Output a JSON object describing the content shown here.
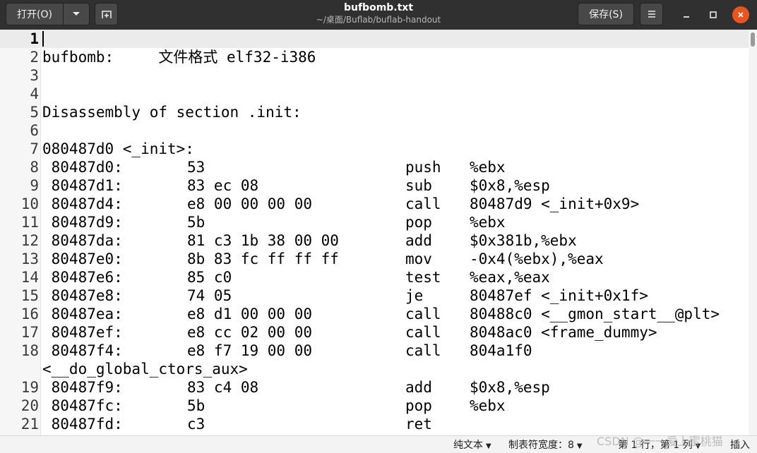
{
  "window": {
    "title": "bufbomb.txt",
    "path": "~/桌面/Buflab/buflab-handout"
  },
  "toolbar": {
    "open_label": "打开(O)",
    "save_label": "保存(S)"
  },
  "editor": {
    "lines": [
      {
        "n": "1",
        "text": ""
      },
      {
        "n": "2",
        "text": "bufbomb:     文件格式 elf32-i386"
      },
      {
        "n": "3",
        "text": ""
      },
      {
        "n": "4",
        "text": ""
      },
      {
        "n": "5",
        "text": "Disassembly of section .init:"
      },
      {
        "n": "6",
        "text": ""
      },
      {
        "n": "7",
        "text": "080487d0 <_init>:"
      },
      {
        "n": "8",
        "addr": " 80487d0:",
        "bytes": "53",
        "mnem": "push",
        "ops": "%ebx"
      },
      {
        "n": "9",
        "addr": " 80487d1:",
        "bytes": "83 ec 08",
        "mnem": "sub",
        "ops": "$0x8,%esp"
      },
      {
        "n": "10",
        "addr": " 80487d4:",
        "bytes": "e8 00 00 00 00",
        "mnem": "call",
        "ops": "80487d9 <_init+0x9>"
      },
      {
        "n": "11",
        "addr": " 80487d9:",
        "bytes": "5b",
        "mnem": "pop",
        "ops": "%ebx"
      },
      {
        "n": "12",
        "addr": " 80487da:",
        "bytes": "81 c3 1b 38 00 00",
        "mnem": "add",
        "ops": "$0x381b,%ebx"
      },
      {
        "n": "13",
        "addr": " 80487e0:",
        "bytes": "8b 83 fc ff ff ff",
        "mnem": "mov",
        "ops": "-0x4(%ebx),%eax"
      },
      {
        "n": "14",
        "addr": " 80487e6:",
        "bytes": "85 c0",
        "mnem": "test",
        "ops": "%eax,%eax"
      },
      {
        "n": "15",
        "addr": " 80487e8:",
        "bytes": "74 05",
        "mnem": "je",
        "ops": "80487ef <_init+0x1f>"
      },
      {
        "n": "16",
        "addr": " 80487ea:",
        "bytes": "e8 d1 00 00 00",
        "mnem": "call",
        "ops": "80488c0 <__gmon_start__@plt>"
      },
      {
        "n": "17",
        "addr": " 80487ef:",
        "bytes": "e8 cc 02 00 00",
        "mnem": "call",
        "ops": "8048ac0 <frame_dummy>"
      },
      {
        "n": "18",
        "addr": " 80487f4:",
        "bytes": "e8 f7 19 00 00",
        "mnem": "call",
        "ops": "804a1f0"
      },
      {
        "n": "",
        "text": "<__do_global_ctors_aux>"
      },
      {
        "n": "19",
        "addr": " 80487f9:",
        "bytes": "83 c4 08",
        "mnem": "add",
        "ops": "$0x8,%esp"
      },
      {
        "n": "20",
        "addr": " 80487fc:",
        "bytes": "5b",
        "mnem": "pop",
        "ops": "%ebx"
      },
      {
        "n": "21",
        "addr": " 80487fd:",
        "bytes": "c3",
        "mnem": "ret",
        "ops": ""
      }
    ]
  },
  "statusbar": {
    "language": "纯文本",
    "tab_width": "制表符宽度：8",
    "position": "第 1 行，第 1 列",
    "mode": "插入"
  },
  "watermark": "CSDN @一一爱上蜜桃猫",
  "icons": {
    "dropdown": "chevron-down-icon",
    "new_tab": "new-tab-icon",
    "menu": "hamburger-icon",
    "minimize": "minimize-icon",
    "maximize": "maximize-icon",
    "close": "close-icon"
  },
  "colors": {
    "headerbar": "#303030",
    "close_button": "#e95420",
    "current_line": "#ebebeb"
  }
}
